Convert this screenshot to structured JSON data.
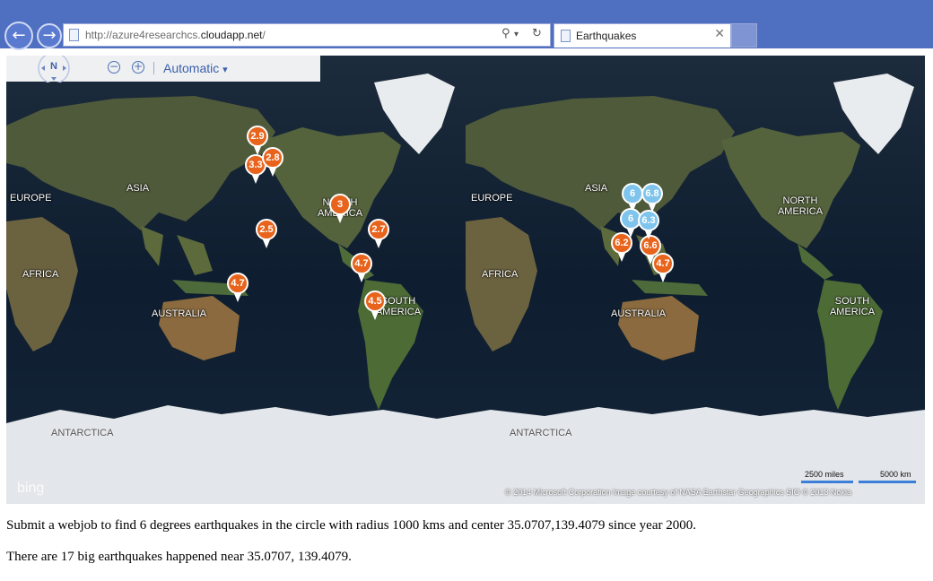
{
  "browser": {
    "url_prefix": "http://azure4researchcs.",
    "url_host": "cloudapp.net",
    "url_suffix": "/",
    "tab_title": "Earthquakes",
    "back_icon": "back-arrow-icon",
    "forward_icon": "forward-arrow-icon",
    "search_icon": "search-icon",
    "refresh_icon": "refresh-icon",
    "close_icon": "close-icon",
    "chrome_color": "#4f6fc0"
  },
  "map": {
    "compass_label": "N",
    "style_label": "Automatic",
    "style_arrow": "▾",
    "zoom_out_symbol": "−",
    "zoom_in_symbol": "+",
    "labels": {
      "europe1": "EUROPE",
      "asia1": "ASIA",
      "north_america1": "NORTH AMERICA",
      "africa1": "AFRICA",
      "australia1": "AUSTRALIA",
      "south_america1": "SOUTH AMERICA",
      "antarctica1": "ANTARCTICA",
      "europe2": "EUROPE",
      "asia2": "ASIA",
      "north_america2": "NORTH AMERICA",
      "africa2": "AFRICA",
      "australia2": "AUSTRALIA",
      "south_america2": "SOUTH AMERICA",
      "antarctica2": "ANTARCTICA"
    },
    "pin_colors": {
      "orange": "#e8641c",
      "blue": "#7fc4ec"
    },
    "pins_orange": [
      "2.9",
      "3.3",
      "2.8",
      "3",
      "2.5",
      "2.7",
      "4.7",
      "4.7",
      "4.5",
      "6.2",
      "6.6",
      "4.7"
    ],
    "pins_blue": [
      "6",
      "6.8",
      "6",
      "6.3"
    ],
    "logo_text": "bing",
    "scale_miles": "2500 miles",
    "scale_km": "5000 km",
    "attribution": "© 2014 Microsoft Corporation    Image courtesy of NASA    Earthstar Geographics SIO    © 2013 Nokia"
  },
  "page": {
    "line1": "Submit a webjob to find 6 degrees earthquakes in the circle with radius 1000 kms and center 35.0707,139.4079 since year 2000.",
    "line2": "There are 17 big earthquakes happened near 35.0707, 139.4079."
  }
}
